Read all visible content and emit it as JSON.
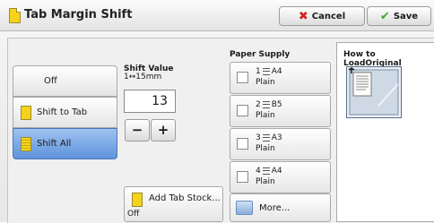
{
  "title": "Tab Margin Shift",
  "header": {
    "cancel_label": "Cancel",
    "save_label": "Save"
  },
  "tabs": [
    {
      "label": "Off",
      "selected": false
    },
    {
      "label": "Shift to Tab",
      "selected": false
    },
    {
      "label": "Shift All",
      "selected": true
    }
  ],
  "shift_value": {
    "title": "Shift Value",
    "range": "1↔15mm",
    "value": "13",
    "minus": "−",
    "plus": "+"
  },
  "paper_supply": {
    "title": "Paper Supply",
    "trays": [
      {
        "number": "1",
        "size": "A4",
        "type": "Plain",
        "checked": false
      },
      {
        "number": "2",
        "size": "B5",
        "type": "Plain",
        "checked": false
      },
      {
        "number": "3",
        "size": "A3",
        "type": "Plain",
        "checked": false
      },
      {
        "number": "4",
        "size": "A4",
        "type": "Plain",
        "checked": false
      }
    ],
    "more_label": "More..."
  },
  "add_tab_stock": {
    "label": "Add Tab Stock...",
    "value": "Off"
  },
  "how_to_load": {
    "title": "How to LoadOriginal"
  },
  "colors": {
    "selected_blue": "#5e93dc",
    "doc_yellow": "#f6d31b",
    "cancel_red": "#d0241b",
    "save_green": "#42a82f"
  }
}
